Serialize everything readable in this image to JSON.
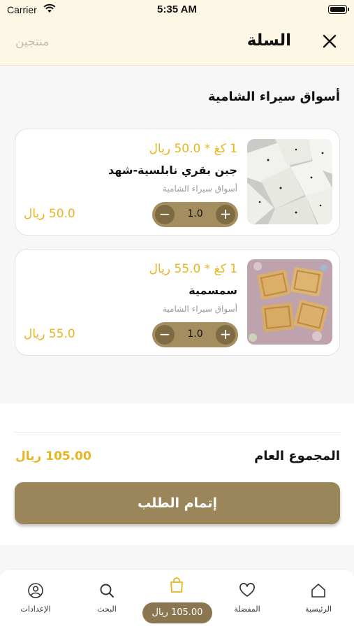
{
  "status_bar": {
    "carrier": "Carrier",
    "time": "5:35 AM"
  },
  "header": {
    "title": "السلة",
    "products_link": "منتجين"
  },
  "store": {
    "name": "أسواق سيراء الشامية"
  },
  "items": [
    {
      "unit_price": "1 كغ * 50.0 ريال",
      "name": "جبن بقري نابلسية-شهد",
      "store": "أسواق سيراء الشامية",
      "quantity": "1.0",
      "line_total": "50.0 ريال",
      "image": "white-cheese-photo"
    },
    {
      "unit_price": "1 كغ * 55.0 ريال",
      "name": "سمسمية",
      "store": "أسواق سيراء الشامية",
      "quantity": "1.0",
      "line_total": "55.0 ريال",
      "image": "sesame-bars-photo"
    }
  ],
  "summary": {
    "total_label": "المجموع العام",
    "total_value": "105.00 ريال",
    "checkout_label": "إتمام الطلب"
  },
  "tabbar": {
    "home": "الرئيسية",
    "favorites": "المفضلة",
    "cart_total": "105.00 ريال",
    "search": "البحث",
    "settings": "الإعدادات"
  },
  "colors": {
    "accent_gold": "#e8b520",
    "button_brown": "#9b855a",
    "stepper": "#a48d5e",
    "header_bg": "#fdf7e6"
  }
}
